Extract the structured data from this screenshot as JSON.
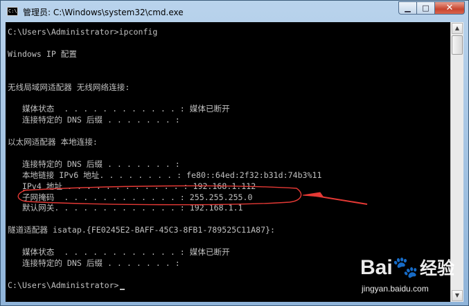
{
  "window": {
    "title": "管理员: C:\\Windows\\system32\\cmd.exe",
    "app_icon_text": "C:\\",
    "minimize_glyph": "▁",
    "maximize_glyph": "□",
    "close_glyph": "✕",
    "icons": [
      "cmd-app-icon",
      "minimize-icon",
      "maximize-icon",
      "close-icon"
    ]
  },
  "console": {
    "lines": [
      "C:\\Users\\Administrator>ipconfig",
      "",
      "Windows IP 配置",
      "",
      "",
      "无线局域网适配器 无线网络连接:",
      "",
      "   媒体状态  . . . . . . . . . . . . : 媒体已断开",
      "   连接特定的 DNS 后缀 . . . . . . . :",
      "",
      "以太网适配器 本地连接:",
      "",
      "   连接特定的 DNS 后缀 . . . . . . . :",
      "   本地链接 IPv6 地址. . . . . . . . : fe80::64ed:2f32:b31d:74b3%11",
      "   IPv4 地址 . . . . . . . . . . . . : 192.168.1.112",
      "   子网掩码  . . . . . . . . . . . . : 255.255.255.0",
      "   默认网关. . . . . . . . . . . . . : 192.168.1.1",
      "",
      "隧道适配器 isatap.{FE0245E2-BAFF-45C3-8FB1-789525C11A87}:",
      "",
      "   媒体状态  . . . . . . . . . . . . : 媒体已断开",
      "   连接特定的 DNS 后缀 . . . . . . . :",
      "",
      "C:\\Users\\Administrator>"
    ],
    "text_color": "#c0c0c0",
    "background": "#000000"
  },
  "scrollbar": {
    "up_glyph": "▲",
    "down_glyph": "▼"
  },
  "annotation": {
    "color": "#e53935",
    "highlighted_line": "IPv4 地址 . . . . . . . . . . . . : 192.168.1.112"
  },
  "watermark": {
    "logo_a": "Bai",
    "logo_paw": "🐾",
    "logo_cn": "经验",
    "url": "jingyan.baidu.com"
  }
}
